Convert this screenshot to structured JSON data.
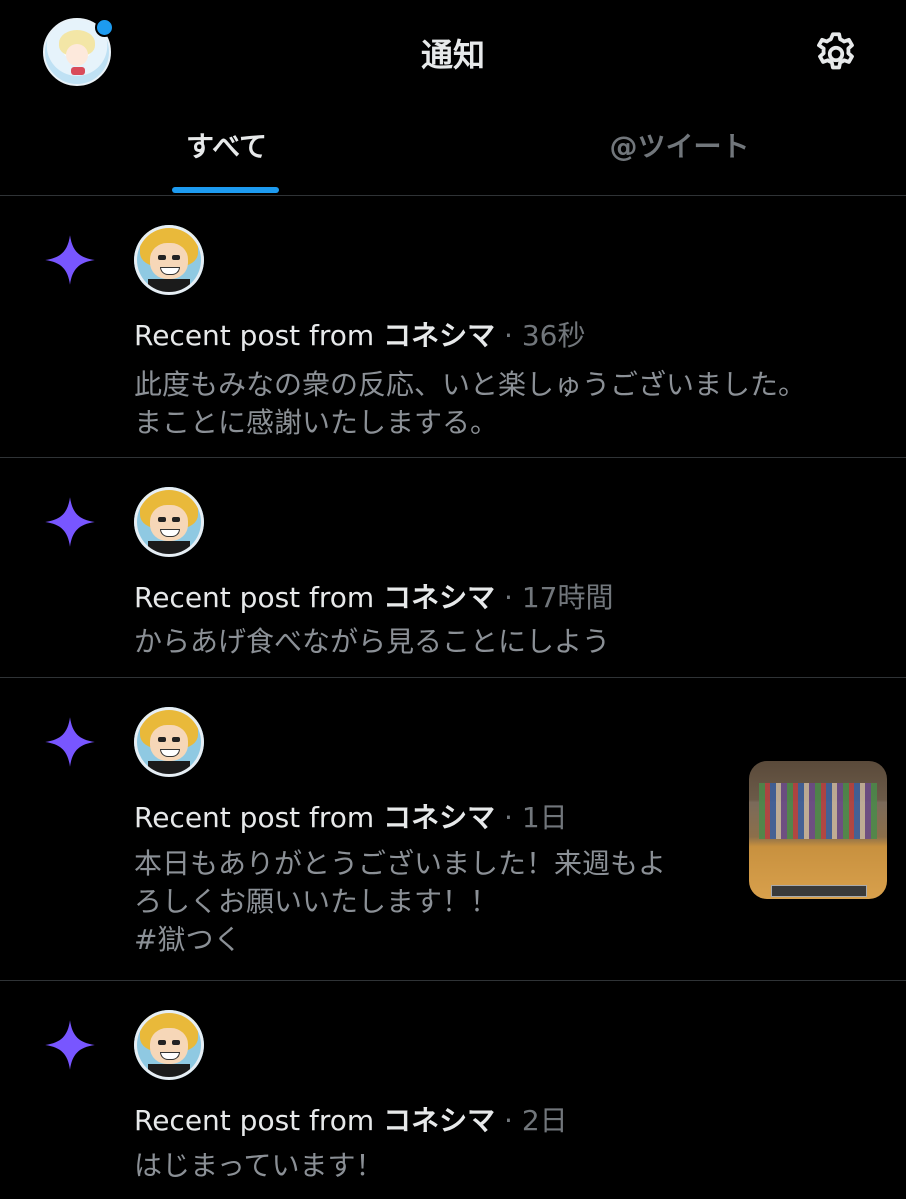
{
  "header": {
    "title": "通知",
    "has_unread_dot": true
  },
  "tabs": [
    {
      "label": "すべて",
      "active": true
    },
    {
      "label": "@ツイート",
      "active": false
    }
  ],
  "accent": "#1d9bf0",
  "spark_color": "#7856ff",
  "notifications": [
    {
      "prefix": "Recent post from ",
      "name": "コネシマ",
      "sep": " · ",
      "time": "36秒",
      "lines": [
        "此度もみなの衆の反応、いと楽しゅうございました。",
        "まことに感謝いたしまする。"
      ]
    },
    {
      "prefix": "Recent post from ",
      "name": "コネシマ",
      "sep": " · ",
      "time": "17時間",
      "lines": [
        "からあげ食べながら見ることにしよう"
      ]
    },
    {
      "prefix": "Recent post from ",
      "name": "コネシマ",
      "sep": " · ",
      "time": "1日",
      "lines": [
        "本日もありがとうございました！来週もよ",
        "ろしくお願いいたします！！",
        "#獄つく"
      ]
    },
    {
      "prefix": "Recent post from ",
      "name": "コネシマ",
      "sep": " · ",
      "time": "2日",
      "lines": [
        "はじまっています！"
      ]
    }
  ],
  "icons": {
    "settings": "gear-icon",
    "notification_type": "sparkle-icon"
  }
}
